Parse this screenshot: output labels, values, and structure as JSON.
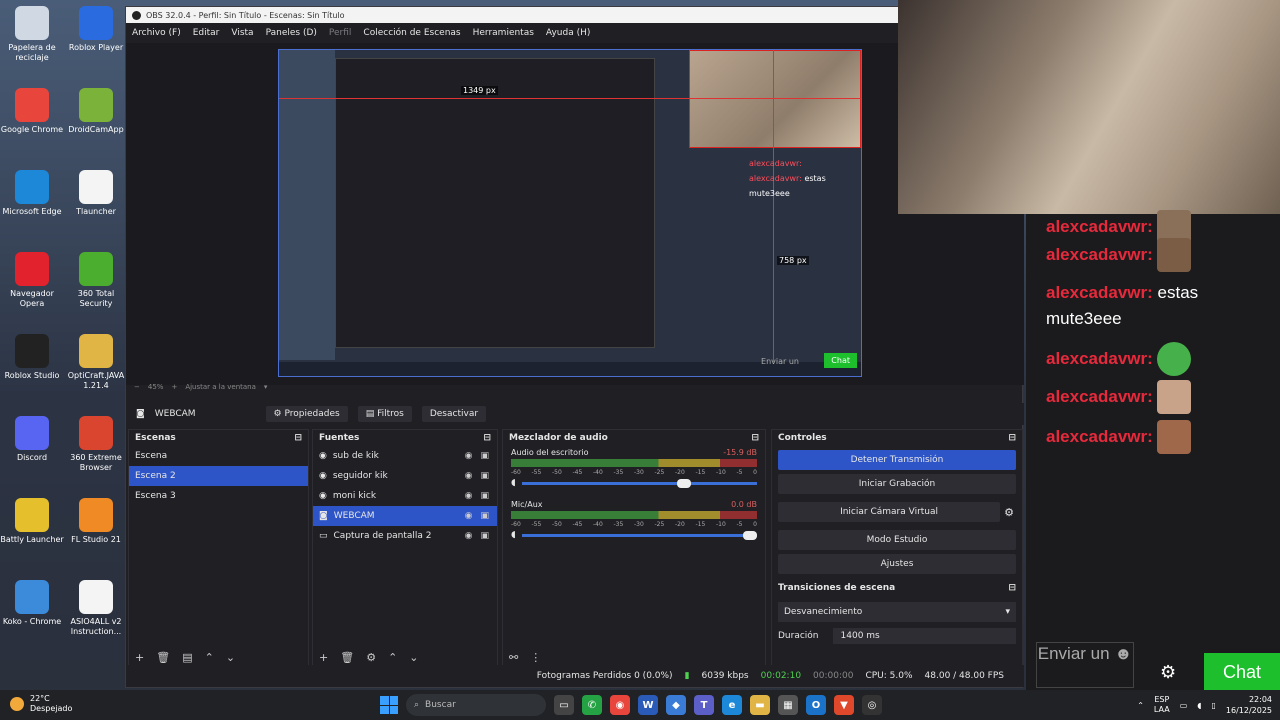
{
  "desktop": {
    "icons": [
      {
        "label": "Papelera de reciclaje",
        "color": "#cfd8e3"
      },
      {
        "label": "Roblox Player",
        "color": "#2a6be0"
      },
      {
        "label": "Google Chrome",
        "color": "#e8453c"
      },
      {
        "label": "DroidCamApp",
        "color": "#7bb33a"
      },
      {
        "label": "Microsoft Edge",
        "color": "#1e88d8"
      },
      {
        "label": "Tlauncher",
        "color": "#f4f4f4"
      },
      {
        "label": "Navegador Opera",
        "color": "#e2222c"
      },
      {
        "label": "360 Total Security",
        "color": "#4cae2f"
      },
      {
        "label": "Roblox Studio",
        "color": "#222222"
      },
      {
        "label": "OptiCraft.JAVA 1.21.4",
        "color": "#e0b545"
      },
      {
        "label": "Discord",
        "color": "#5865f2"
      },
      {
        "label": "360 Extreme Browser",
        "color": "#d9452e"
      },
      {
        "label": "Battly Launcher",
        "color": "#e6c02c"
      },
      {
        "label": "FL Studio 21",
        "color": "#f08a24"
      },
      {
        "label": "Koko - Chrome",
        "color": "#3c8bdb"
      },
      {
        "label": "ASIO4ALL v2 Instruction...",
        "color": "#f4f4f4"
      }
    ]
  },
  "obs": {
    "title": "OBS 32.0.4 - Perfil: Sin Título - Escenas: Sin Título",
    "menu": [
      "Archivo (F)",
      "Editar",
      "Vista",
      "Paneles (D)",
      "Perfil",
      "Colección de Escenas",
      "Herramientas",
      "Ayuda (H)"
    ],
    "preview": {
      "px_h": "1349 px",
      "px_v": "758 px",
      "mini_chat_user": "alexcadavwr:",
      "mini_chat_msg": "estas mute3eee",
      "mini_send": "Enviar un",
      "mini_chat_btn": "Chat"
    },
    "zoom": "45%",
    "fit_label": "Ajustar a la ventana",
    "toolbar": {
      "selected": "WEBCAM",
      "properties": "Propiedades",
      "filters": "Filtros",
      "deactivate": "Desactivar"
    },
    "scenes": {
      "title": "Escenas",
      "items": [
        "Escena",
        "Escena 2",
        "Escena 3"
      ],
      "active_index": 1
    },
    "sources": {
      "title": "Fuentes",
      "items": [
        {
          "name": "sub de kik",
          "icon": "audio"
        },
        {
          "name": "seguidor kik",
          "icon": "audio"
        },
        {
          "name": "moni kick",
          "icon": "audio"
        },
        {
          "name": "WEBCAM",
          "icon": "camera"
        },
        {
          "name": "Captura de pantalla 2",
          "icon": "monitor"
        }
      ],
      "active_index": 3
    },
    "mixer": {
      "title": "Mezclador de audio",
      "channels": [
        {
          "name": "Audio del escritorio",
          "db": "-15.9 dB",
          "level": 0.72
        },
        {
          "name": "Mic/Aux",
          "db": "0.0 dB",
          "level": 1.0
        }
      ],
      "scale": [
        "-60",
        "-55",
        "-50",
        "-45",
        "-40",
        "-35",
        "-30",
        "-25",
        "-20",
        "-15",
        "-10",
        "-5",
        "0"
      ]
    },
    "controls": {
      "title": "Controles",
      "stop_stream": "Detener Transmisión",
      "start_recording": "Iniciar Grabación",
      "virtual_cam": "Iniciar Cámara Virtual",
      "studio_mode": "Modo Estudio",
      "settings": "Ajustes"
    },
    "transitions": {
      "title": "Transiciones de escena",
      "selected": "Desvanecimiento",
      "duration_label": "Duración",
      "duration_value": "1400 ms"
    },
    "status": {
      "dropped": "Fotogramas Perdidos 0 (0.0%)",
      "bitrate": "6039 kbps",
      "stream_time": "00:02:10",
      "rec_time": "00:00:00",
      "cpu": "CPU: 5.0%",
      "fps": "48.00 / 48.00 FPS"
    }
  },
  "chat": {
    "user": "alexcadavwr:",
    "message_prefix": "alexcadavwr:",
    "message": "estas mute3eee",
    "send_placeholder": "Enviar un",
    "button": "Chat"
  },
  "taskbar": {
    "temp": "22°C",
    "weather": "Despejado",
    "search": "Buscar",
    "lang_top": "ESP",
    "lang_bottom": "LAA",
    "time": "22:04",
    "date": "16/12/2025"
  },
  "colors": {
    "accent": "#2e55c8",
    "chat_green": "#1dbf2c",
    "username_red": "#e8293b"
  }
}
